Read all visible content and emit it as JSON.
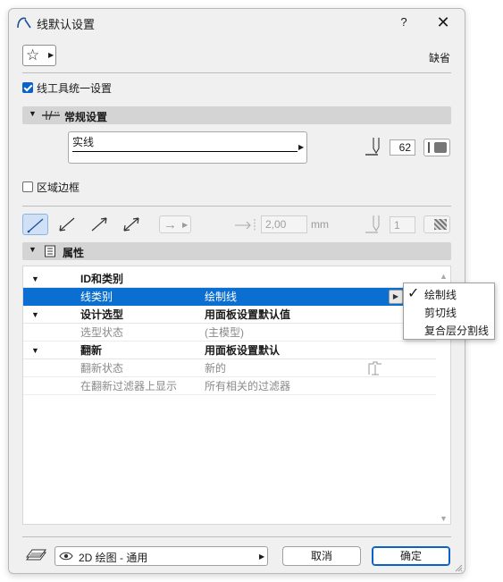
{
  "window": {
    "title": "线默认设置",
    "help_label": "?",
    "close_label": "✕"
  },
  "header": {
    "default_label": "缺省"
  },
  "options": {
    "unify_label": "线工具统一设置",
    "unify_checked": true
  },
  "general": {
    "title": "常规设置",
    "line_type": "实线",
    "pen_number": "62"
  },
  "region_border": {
    "label": "区域边框",
    "checked": false
  },
  "geometry": {
    "arrow_label": "→",
    "offset_value": "2,00",
    "offset_unit": "mm",
    "arrow_pen_value": "1"
  },
  "properties": {
    "title": "属性",
    "rows": [
      {
        "type": "group",
        "name": "ID和类别",
        "value": ""
      },
      {
        "type": "selected",
        "name": "线类别",
        "value": "绘制线"
      },
      {
        "type": "group",
        "name": "设计选型",
        "value": "用面板设置默认值"
      },
      {
        "type": "item",
        "name": "选型状态",
        "value": "(主模型)"
      },
      {
        "type": "group",
        "name": "翻新",
        "value": "用面板设置默认"
      },
      {
        "type": "item",
        "name": "翻新状态",
        "value": "新的"
      },
      {
        "type": "item",
        "name": "在翻新过滤器上显示",
        "value": "所有相关的过滤器"
      }
    ]
  },
  "popup": {
    "options": [
      "绘制线",
      "剪切线",
      "复合层分割线"
    ],
    "selected_index": 0
  },
  "footer": {
    "layer_combo": "2D 绘图 - 通用",
    "cancel_label": "取消",
    "ok_label": "确定"
  },
  "colors": {
    "accent": "#0a6fd1",
    "checkbox": "#0a61c9"
  }
}
